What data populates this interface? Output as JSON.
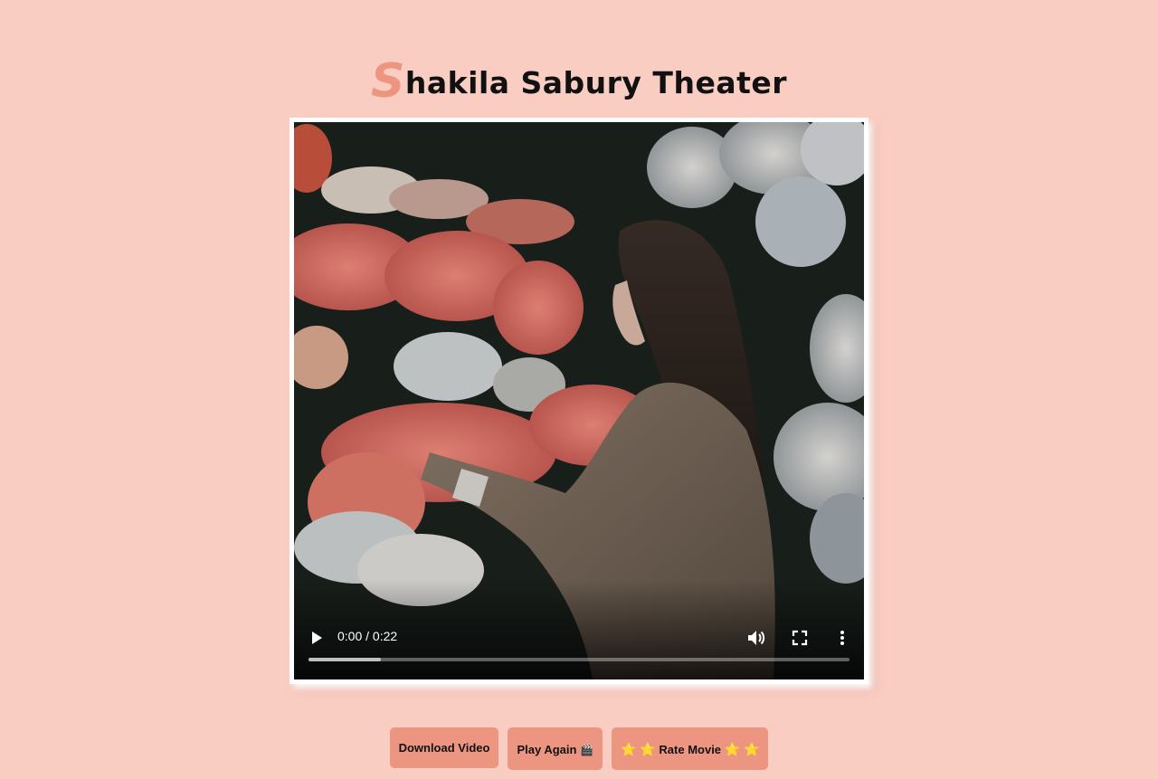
{
  "page": {
    "title_first_letter": "S",
    "title_rest": "hakila Sabury Theater"
  },
  "video": {
    "time_display": "0:00 / 0:22",
    "progress_fraction": 0,
    "buffered_fraction": 0.134,
    "icons": {
      "play": "play-icon",
      "volume": "volume-icon",
      "fullscreen": "fullscreen-icon",
      "more": "more-options-icon"
    }
  },
  "buttons": {
    "download_label": "Download Video",
    "play_again_label": "Play Again",
    "play_again_emoji": "🎬",
    "rate_label": "Rate Movie",
    "rate_star_left": "⭐ ⭐",
    "rate_star_right": "⭐ ⭐"
  },
  "colors": {
    "background": "#facdc2",
    "accent": "#ec9682",
    "button": "#ec9682"
  }
}
